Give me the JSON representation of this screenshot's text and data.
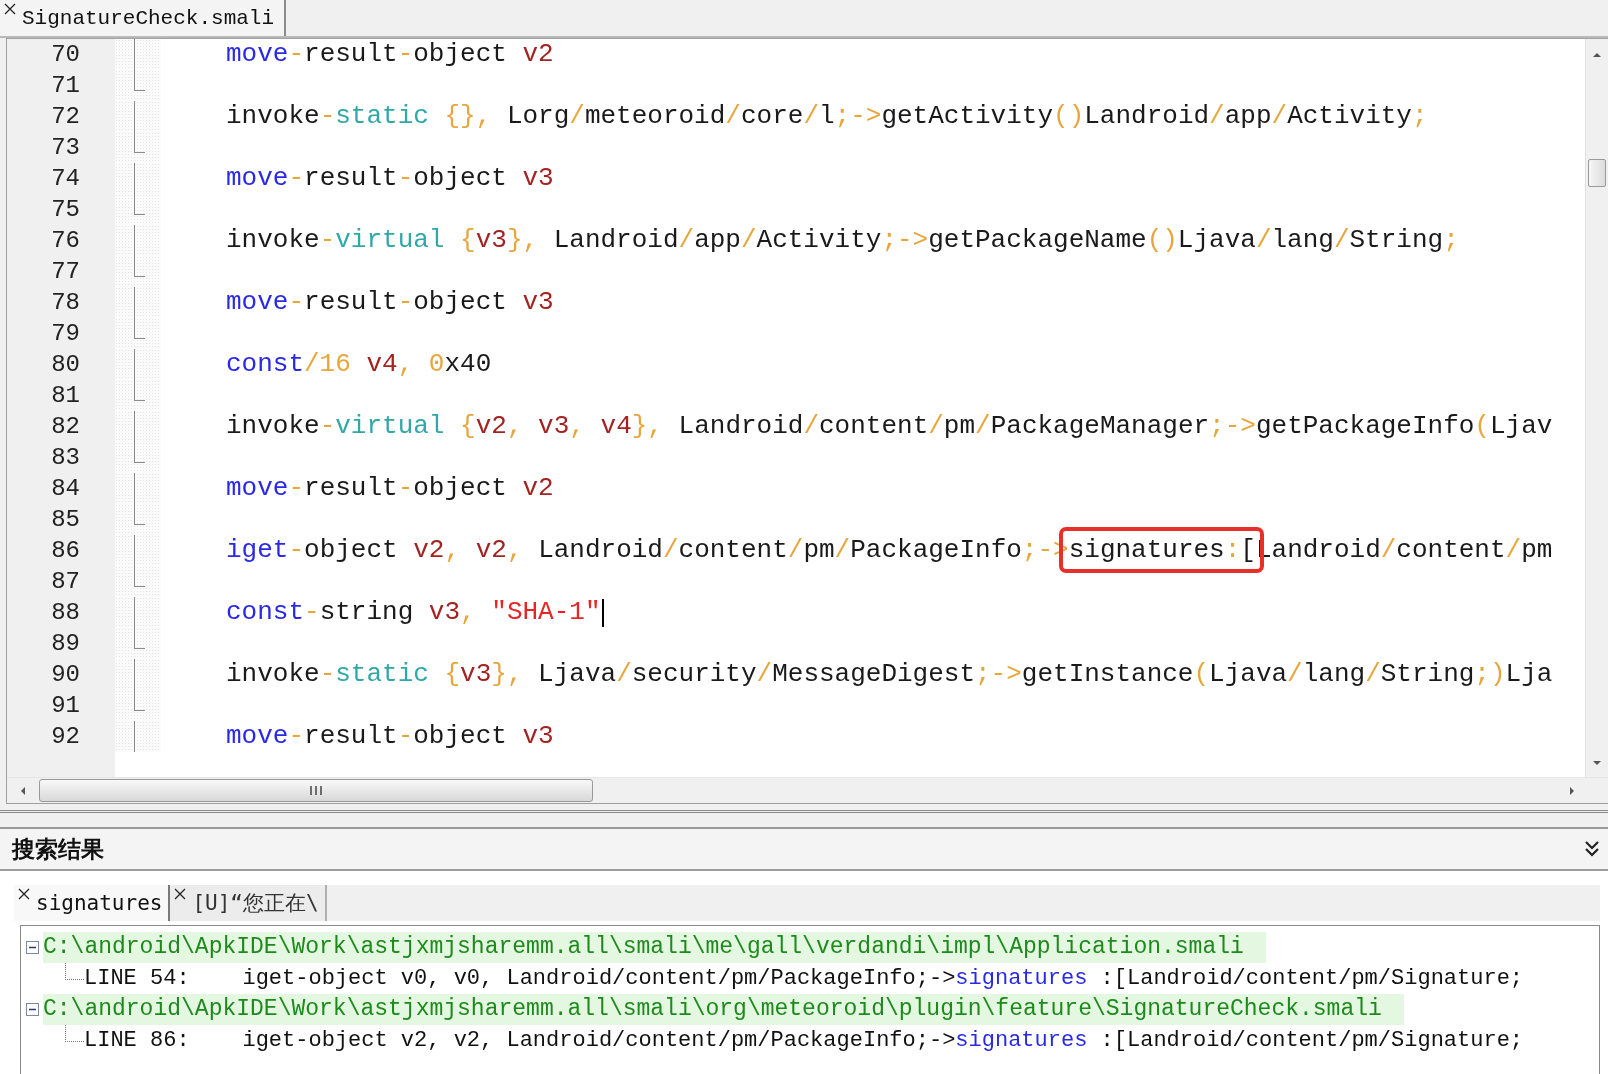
{
  "editor_tabs": [
    {
      "label": "SignatureCheck.smali",
      "selected": true
    }
  ],
  "editor": {
    "lines": [
      {
        "number": "70",
        "fold_end": false,
        "tokens": [
          {
            "kind": "kw",
            "text": "move"
          },
          {
            "kind": "op",
            "text": "-"
          },
          {
            "kind": "id",
            "text": "result"
          },
          {
            "kind": "op",
            "text": "-"
          },
          {
            "kind": "id",
            "text": "object"
          },
          {
            "kind": "reg",
            "text": " v2"
          }
        ]
      },
      {
        "number": "71",
        "fold_end": true
      },
      {
        "number": "72",
        "fold_end": false,
        "tokens": [
          {
            "kind": "id",
            "text": "invoke"
          },
          {
            "kind": "op",
            "text": "-"
          },
          {
            "kind": "mod",
            "text": "static"
          },
          {
            "kind": "op",
            "text": " {}, "
          },
          {
            "kind": "id",
            "text": "Lorg"
          },
          {
            "kind": "op",
            "text": "/"
          },
          {
            "kind": "id",
            "text": "meteoroid"
          },
          {
            "kind": "op",
            "text": "/"
          },
          {
            "kind": "id",
            "text": "core"
          },
          {
            "kind": "op",
            "text": "/"
          },
          {
            "kind": "id",
            "text": "l"
          },
          {
            "kind": "op",
            "text": ";->"
          },
          {
            "kind": "id",
            "text": "getActivity"
          },
          {
            "kind": "op",
            "text": "()"
          },
          {
            "kind": "id",
            "text": "Landroid"
          },
          {
            "kind": "op",
            "text": "/"
          },
          {
            "kind": "id",
            "text": "app"
          },
          {
            "kind": "op",
            "text": "/"
          },
          {
            "kind": "id",
            "text": "Activity"
          },
          {
            "kind": "op",
            "text": ";"
          }
        ]
      },
      {
        "number": "73",
        "fold_end": true
      },
      {
        "number": "74",
        "fold_end": false,
        "tokens": [
          {
            "kind": "kw",
            "text": "move"
          },
          {
            "kind": "op",
            "text": "-"
          },
          {
            "kind": "id",
            "text": "result"
          },
          {
            "kind": "op",
            "text": "-"
          },
          {
            "kind": "id",
            "text": "object"
          },
          {
            "kind": "reg",
            "text": " v3"
          }
        ]
      },
      {
        "number": "75",
        "fold_end": true
      },
      {
        "number": "76",
        "fold_end": false,
        "tokens": [
          {
            "kind": "id",
            "text": "invoke"
          },
          {
            "kind": "op",
            "text": "-"
          },
          {
            "kind": "mod",
            "text": "virtual"
          },
          {
            "kind": "op",
            "text": " {"
          },
          {
            "kind": "reg",
            "text": "v3"
          },
          {
            "kind": "op",
            "text": "}, "
          },
          {
            "kind": "id",
            "text": "Landroid"
          },
          {
            "kind": "op",
            "text": "/"
          },
          {
            "kind": "id",
            "text": "app"
          },
          {
            "kind": "op",
            "text": "/"
          },
          {
            "kind": "id",
            "text": "Activity"
          },
          {
            "kind": "op",
            "text": ";->"
          },
          {
            "kind": "id",
            "text": "getPackageName"
          },
          {
            "kind": "op",
            "text": "()"
          },
          {
            "kind": "id",
            "text": "Ljava"
          },
          {
            "kind": "op",
            "text": "/"
          },
          {
            "kind": "id",
            "text": "lang"
          },
          {
            "kind": "op",
            "text": "/"
          },
          {
            "kind": "id",
            "text": "String"
          },
          {
            "kind": "op",
            "text": ";"
          }
        ]
      },
      {
        "number": "77",
        "fold_end": true
      },
      {
        "number": "78",
        "fold_end": false,
        "tokens": [
          {
            "kind": "kw",
            "text": "move"
          },
          {
            "kind": "op",
            "text": "-"
          },
          {
            "kind": "id",
            "text": "result"
          },
          {
            "kind": "op",
            "text": "-"
          },
          {
            "kind": "id",
            "text": "object"
          },
          {
            "kind": "reg",
            "text": " v3"
          }
        ]
      },
      {
        "number": "79",
        "fold_end": true
      },
      {
        "number": "80",
        "fold_end": false,
        "tokens": [
          {
            "kind": "kw",
            "text": "const"
          },
          {
            "kind": "op",
            "text": "/16"
          },
          {
            "kind": "reg",
            "text": " v4"
          },
          {
            "kind": "op",
            "text": ", 0"
          },
          {
            "kind": "id",
            "text": "x40"
          }
        ]
      },
      {
        "number": "81",
        "fold_end": true
      },
      {
        "number": "82",
        "fold_end": false,
        "tokens": [
          {
            "kind": "id",
            "text": "invoke"
          },
          {
            "kind": "op",
            "text": "-"
          },
          {
            "kind": "mod",
            "text": "virtual"
          },
          {
            "kind": "op",
            "text": " {"
          },
          {
            "kind": "reg",
            "text": "v2"
          },
          {
            "kind": "op",
            "text": ", "
          },
          {
            "kind": "reg",
            "text": "v3"
          },
          {
            "kind": "op",
            "text": ", "
          },
          {
            "kind": "reg",
            "text": "v4"
          },
          {
            "kind": "op",
            "text": "}, "
          },
          {
            "kind": "id",
            "text": "Landroid"
          },
          {
            "kind": "op",
            "text": "/"
          },
          {
            "kind": "id",
            "text": "content"
          },
          {
            "kind": "op",
            "text": "/"
          },
          {
            "kind": "id",
            "text": "pm"
          },
          {
            "kind": "op",
            "text": "/"
          },
          {
            "kind": "id",
            "text": "PackageManager"
          },
          {
            "kind": "op",
            "text": ";->"
          },
          {
            "kind": "id",
            "text": "getPackageInfo"
          },
          {
            "kind": "op",
            "text": "("
          },
          {
            "kind": "id",
            "text": "Ljav"
          }
        ]
      },
      {
        "number": "83",
        "fold_end": true
      },
      {
        "number": "84",
        "fold_end": false,
        "tokens": [
          {
            "kind": "kw",
            "text": "move"
          },
          {
            "kind": "op",
            "text": "-"
          },
          {
            "kind": "id",
            "text": "result"
          },
          {
            "kind": "op",
            "text": "-"
          },
          {
            "kind": "id",
            "text": "object"
          },
          {
            "kind": "reg",
            "text": " v2"
          }
        ]
      },
      {
        "number": "85",
        "fold_end": true
      },
      {
        "number": "86",
        "fold_end": false,
        "tokens": [
          {
            "kind": "kw",
            "text": "iget"
          },
          {
            "kind": "op",
            "text": "-"
          },
          {
            "kind": "id",
            "text": "object"
          },
          {
            "kind": "reg",
            "text": " v2"
          },
          {
            "kind": "op",
            "text": ", "
          },
          {
            "kind": "reg",
            "text": "v2"
          },
          {
            "kind": "op",
            "text": ", "
          },
          {
            "kind": "id",
            "text": "Landroid"
          },
          {
            "kind": "op",
            "text": "/"
          },
          {
            "kind": "id",
            "text": "content"
          },
          {
            "kind": "op",
            "text": "/"
          },
          {
            "kind": "id",
            "text": "pm"
          },
          {
            "kind": "op",
            "text": "/"
          },
          {
            "kind": "id",
            "text": "PackageInfo"
          },
          {
            "kind": "op",
            "text": ";->"
          },
          {
            "kind": "highlight",
            "tokens": [
              {
                "kind": "id",
                "text": "signatures"
              },
              {
                "kind": "op",
                "text": ":"
              },
              {
                "kind": "id",
                "text": "["
              }
            ]
          },
          {
            "kind": "id",
            "text": "Landroid"
          },
          {
            "kind": "op",
            "text": "/"
          },
          {
            "kind": "id",
            "text": "content"
          },
          {
            "kind": "op",
            "text": "/"
          },
          {
            "kind": "id",
            "text": "pm"
          }
        ]
      },
      {
        "number": "87",
        "fold_end": true
      },
      {
        "number": "88",
        "fold_end": false,
        "cursor": true,
        "tokens": [
          {
            "kind": "kw",
            "text": "const"
          },
          {
            "kind": "op",
            "text": "-"
          },
          {
            "kind": "id",
            "text": "string"
          },
          {
            "kind": "reg",
            "text": " v3"
          },
          {
            "kind": "op",
            "text": ", "
          },
          {
            "kind": "str",
            "text": "\"SHA-1\""
          }
        ]
      },
      {
        "number": "89",
        "fold_end": true
      },
      {
        "number": "90",
        "fold_end": false,
        "tokens": [
          {
            "kind": "id",
            "text": "invoke"
          },
          {
            "kind": "op",
            "text": "-"
          },
          {
            "kind": "mod",
            "text": "static"
          },
          {
            "kind": "op",
            "text": " {"
          },
          {
            "kind": "reg",
            "text": "v3"
          },
          {
            "kind": "op",
            "text": "}, "
          },
          {
            "kind": "id",
            "text": "Ljava"
          },
          {
            "kind": "op",
            "text": "/"
          },
          {
            "kind": "id",
            "text": "security"
          },
          {
            "kind": "op",
            "text": "/"
          },
          {
            "kind": "id",
            "text": "MessageDigest"
          },
          {
            "kind": "op",
            "text": ";->"
          },
          {
            "kind": "id",
            "text": "getInstance"
          },
          {
            "kind": "op",
            "text": "("
          },
          {
            "kind": "id",
            "text": "Ljava"
          },
          {
            "kind": "op",
            "text": "/"
          },
          {
            "kind": "id",
            "text": "lang"
          },
          {
            "kind": "op",
            "text": "/"
          },
          {
            "kind": "id",
            "text": "String"
          },
          {
            "kind": "op",
            "text": ";)"
          },
          {
            "kind": "id",
            "text": "Lja"
          }
        ]
      },
      {
        "number": "91",
        "fold_end": true
      },
      {
        "number": "92",
        "fold_end": false,
        "tokens": [
          {
            "kind": "kw",
            "text": "move"
          },
          {
            "kind": "op",
            "text": "-"
          },
          {
            "kind": "id",
            "text": "result"
          },
          {
            "kind": "op",
            "text": "-"
          },
          {
            "kind": "id",
            "text": "object"
          },
          {
            "kind": "reg",
            "text": " v3"
          }
        ]
      }
    ]
  },
  "search_panel": {
    "title": "搜索结果",
    "tabs": [
      {
        "label": "signatures",
        "selected": true
      },
      {
        "label": "[U]“您正在\\",
        "selected": false
      }
    ],
    "results": [
      {
        "path": "C:\\android\\ApkIDE\\Work\\astjxmjsharemm.all\\smali\\me\\gall\\verdandi\\impl\\Application.smali",
        "expanded": true,
        "children": [
          {
            "segments": [
              {
                "kind": "plain",
                "text": "LINE 54:    iget-object v0, v0, Landroid/content/pm/PackageInfo;->"
              },
              {
                "kind": "match",
                "text": "signatures"
              },
              {
                "kind": "plain",
                "text": " :[Landroid/content/pm/Signature;"
              }
            ]
          }
        ]
      },
      {
        "path": "C:\\android\\ApkIDE\\Work\\astjxmjsharemm.all\\smali\\org\\meteoroid\\plugin\\feature\\SignatureCheck.smali",
        "expanded": true,
        "children": [
          {
            "segments": [
              {
                "kind": "plain",
                "text": "LINE 86:    iget-object v2, v2, Landroid/content/pm/PackageInfo;->"
              },
              {
                "kind": "match",
                "text": "signatures"
              },
              {
                "kind": "plain",
                "text": " :[Landroid/content/pm/Signature;"
              }
            ]
          }
        ]
      }
    ]
  }
}
